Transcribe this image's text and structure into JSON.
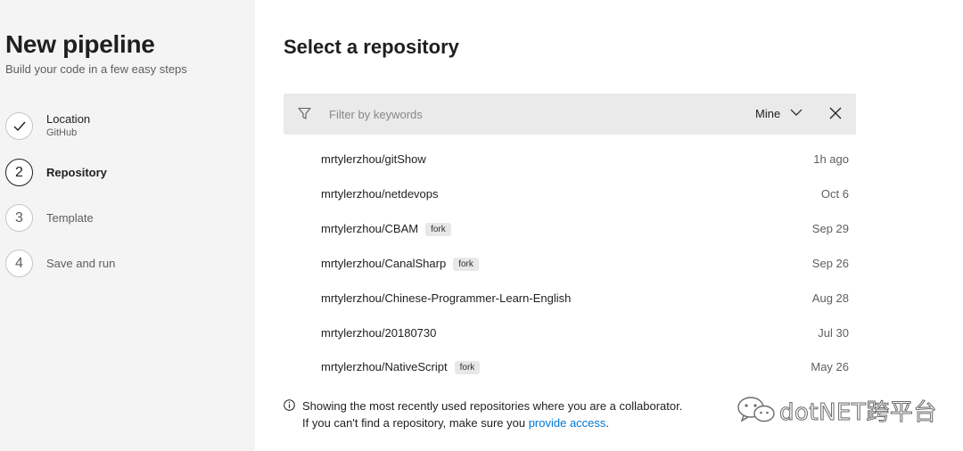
{
  "sidebar": {
    "title": "New pipeline",
    "subtitle": "Build your code in a few easy steps",
    "steps": [
      {
        "number": "",
        "label": "Location",
        "sub": "GitHub",
        "state": "done"
      },
      {
        "number": "2",
        "label": "Repository",
        "state": "active"
      },
      {
        "number": "3",
        "label": "Template",
        "state": "todo"
      },
      {
        "number": "4",
        "label": "Save and run",
        "state": "todo"
      }
    ]
  },
  "main": {
    "title": "Select a repository",
    "filter": {
      "placeholder": "Filter by keywords",
      "scope": "Mine"
    },
    "repos": [
      {
        "name": "mrtylerzhou/gitShow",
        "fork": "",
        "date": "1h ago"
      },
      {
        "name": "mrtylerzhou/netdevops",
        "fork": "",
        "date": "Oct 6"
      },
      {
        "name": "mrtylerzhou/CBAM",
        "fork": "fork",
        "date": "Sep 29"
      },
      {
        "name": "mrtylerzhou/CanalSharp",
        "fork": "fork",
        "date": "Sep 26"
      },
      {
        "name": "mrtylerzhou/Chinese-Programmer-Learn-English",
        "fork": "",
        "date": "Aug 28"
      },
      {
        "name": "mrtylerzhou/20180730",
        "fork": "",
        "date": "Jul 30"
      },
      {
        "name": "mrtylerzhou/NativeScript",
        "fork": "fork",
        "date": "May 26"
      }
    ],
    "info": {
      "line1": "Showing the most recently used repositories where you are a collaborator.",
      "line2_prefix": "If you can't find a repository, make sure you ",
      "line2_link": "provide access",
      "line2_suffix": "."
    }
  },
  "watermark": {
    "text": "dotNET跨平台"
  },
  "icons": {
    "step1": "check-icon",
    "filter": "funnel-icon",
    "scope": "chevron-down-icon",
    "clear": "close-icon",
    "info": "info-icon",
    "watermark": "wechat-icon"
  },
  "colors": {
    "sidebar_bg": "#f4f4f4",
    "filter_bg": "#eaeaea",
    "link": "#0078d4",
    "text": "#201f1e",
    "muted": "#605e5c"
  }
}
